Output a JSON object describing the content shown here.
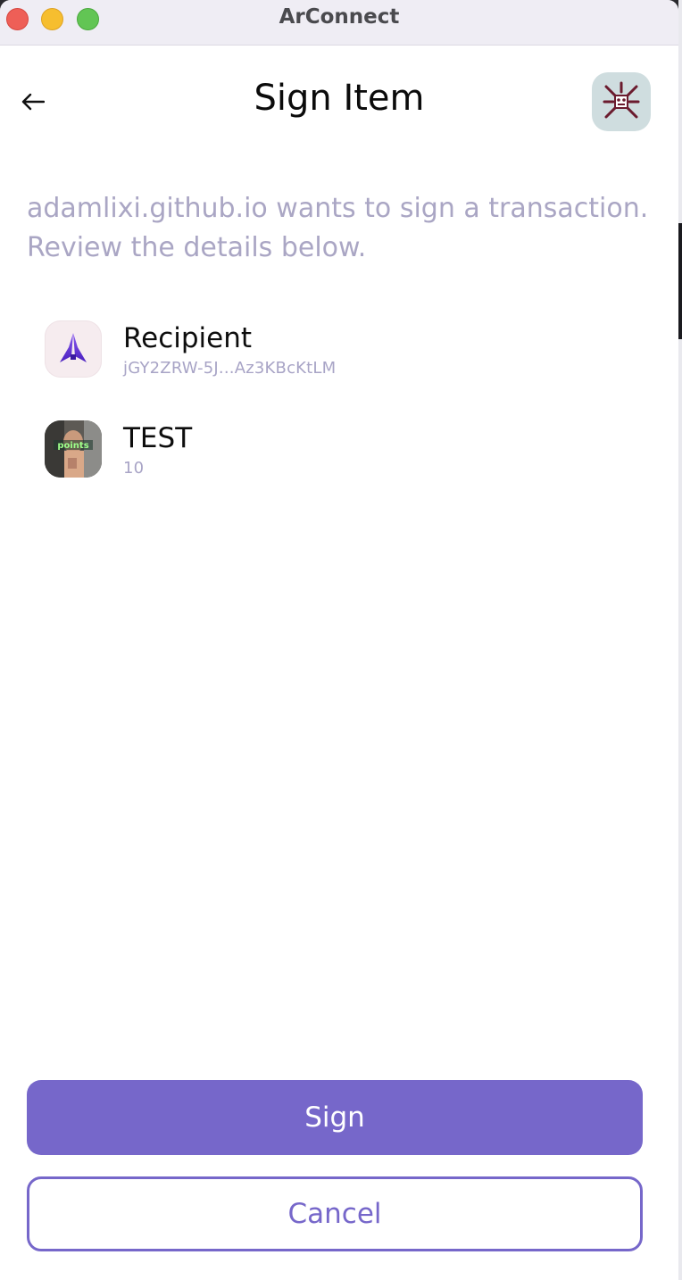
{
  "window": {
    "title": "ArConnect"
  },
  "header": {
    "title": "Sign Item",
    "back_icon": "arrow-left-icon",
    "avatar_icon": "wallet-avatar-icon"
  },
  "description": "adamlixi.github.io wants to sign a transaction. Review the details below.",
  "items": [
    {
      "title": "Recipient",
      "subtitle": "jGY2ZRW-5J...Az3KBcKtLM",
      "icon": "recipient-logo-icon"
    },
    {
      "title": "TEST",
      "subtitle": "10",
      "icon": "token-image-icon",
      "icon_text": "points"
    }
  ],
  "actions": {
    "sign_label": "Sign",
    "cancel_label": "Cancel"
  },
  "colors": {
    "accent": "#7667ca",
    "muted_text": "#aaa6c4",
    "titlebar": "#efedf4"
  }
}
